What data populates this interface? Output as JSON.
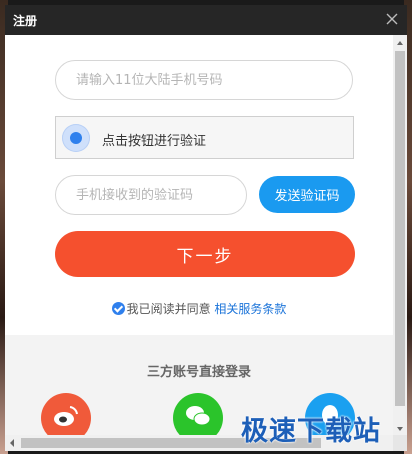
{
  "window": {
    "title": "注册"
  },
  "form": {
    "phone_placeholder": "请输入11位大陆手机号码",
    "captcha_label": "点击按钮进行验证",
    "code_placeholder": "手机接收到的验证码",
    "send_code_label": "发送验证码",
    "next_label": "下一步"
  },
  "agreement": {
    "prefix": "我已阅读并同意",
    "link": "相关服务条款"
  },
  "third_party": {
    "title": "三方账号直接登录",
    "providers": [
      "weibo-icon",
      "wechat-icon",
      "qq-icon"
    ]
  },
  "watermark": "极速下载站",
  "colors": {
    "titlebar": "#262626",
    "primary_blue": "#1a9af0",
    "next_orange": "#f5502e",
    "weibo": "#f05a3a",
    "wechat": "#2bc42b",
    "qq": "#1aa0f0"
  }
}
